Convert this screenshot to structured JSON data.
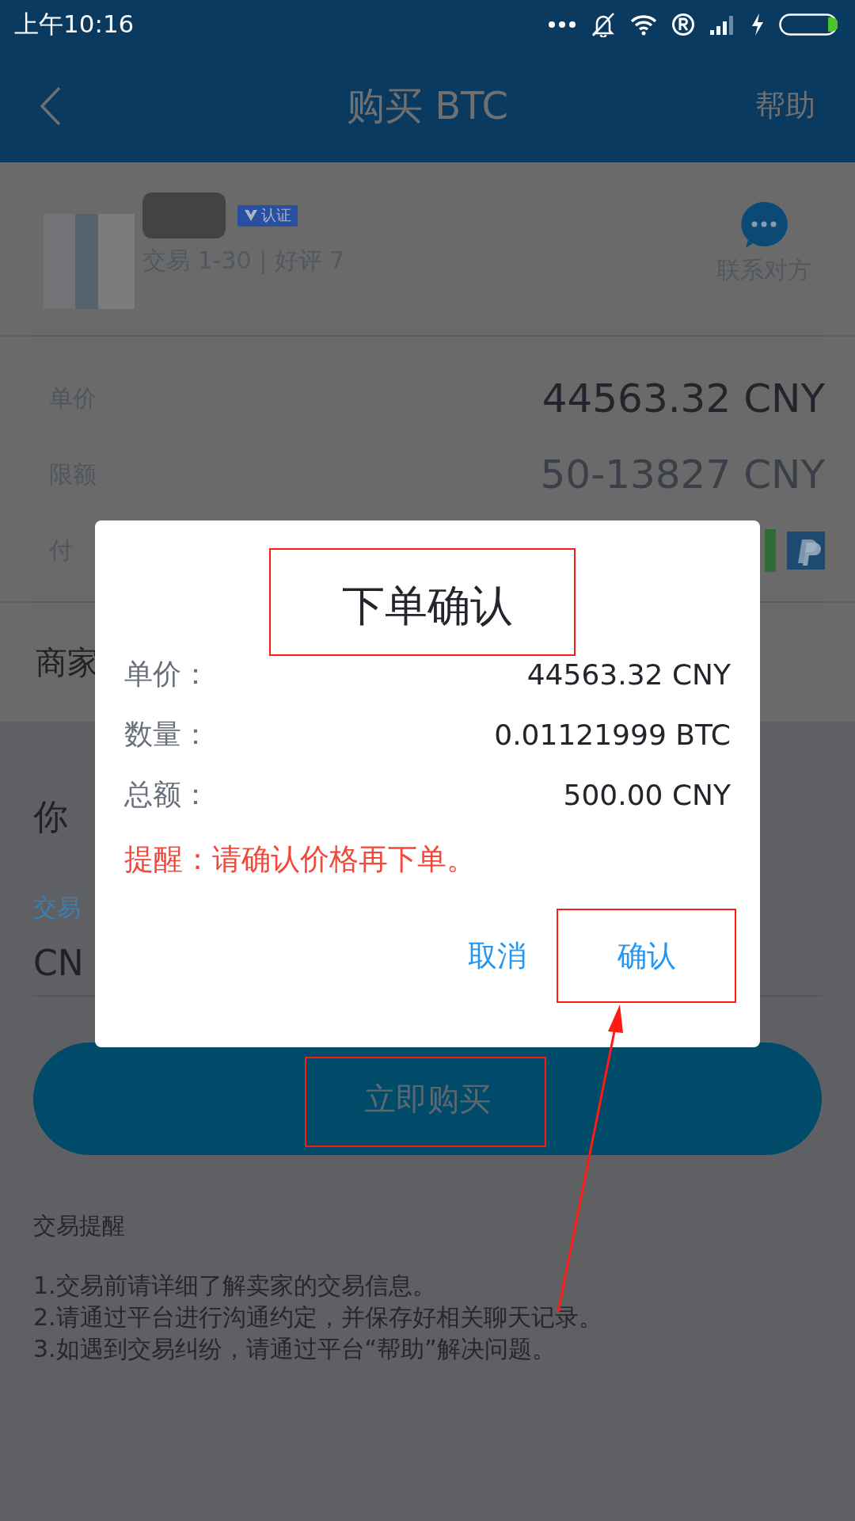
{
  "status_bar": {
    "time": "上午10:16"
  },
  "header": {
    "title": "购买 BTC",
    "action": "帮助"
  },
  "merchant": {
    "badge": "认证",
    "stats": "交易 1-30 | 好评 7",
    "contact": "联系对方"
  },
  "details": [
    {
      "kind": "text",
      "label": "单价",
      "value": "44563.32 CNY"
    },
    {
      "kind": "text",
      "label": "限额",
      "value": "50-13827 CNY"
    },
    {
      "kind": "payment",
      "label": "付"
    }
  ],
  "merchant_note": "商家",
  "form": {
    "heading": "你",
    "field_label": "交易",
    "field_value": "CN"
  },
  "buy_button": "立即购买",
  "tips": {
    "title": "交易提醒",
    "items": [
      "1.交易前请详细了解卖家的交易信息。",
      "2.请通过平台进行沟通约定，并保存好相关聊天记录。",
      "3.如遇到交易纠纷，请通过平台“帮助”解决问题。"
    ]
  },
  "dialog": {
    "title": "下单确认",
    "rows": [
      {
        "label": "单价：",
        "value": "44563.32 CNY"
      },
      {
        "label": "数量：",
        "value": "0.01121999 BTC"
      },
      {
        "label": "总额：",
        "value": "500.00 CNY"
      }
    ],
    "warning": "提醒：请确认价格再下单。",
    "buttons": [
      {
        "label": "取消",
        "annotated": false
      },
      {
        "label": "确认",
        "annotated": true
      }
    ]
  }
}
